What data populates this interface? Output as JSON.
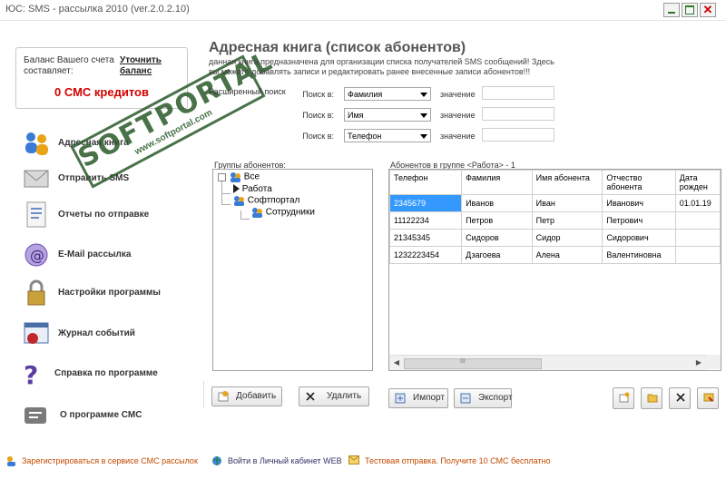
{
  "window": {
    "title": "ЮС: SMS - рассылка 2010 (ver.2.0.2.10)",
    "close_glyph": "✕"
  },
  "balance": {
    "label": "Баланс Вашего счета составляет:",
    "refresh_link": "Уточнить баланс",
    "value": "0 СМС кредитов",
    "value_color": "#d40000"
  },
  "nav": [
    {
      "label": "Адресная книга",
      "icon": "address-book-icon"
    },
    {
      "label": "Отправить SMS",
      "icon": "envelope-icon"
    },
    {
      "label": "Отчеты по отправке",
      "icon": "report-icon"
    },
    {
      "label": "E-Mail рассылка",
      "icon": "email-icon"
    },
    {
      "label": "Настройки программы",
      "icon": "lock-icon"
    },
    {
      "label": "Журнал событий",
      "icon": "log-icon"
    },
    {
      "label": "Справка по программе",
      "icon": "help-icon"
    },
    {
      "label": "О программе СМС",
      "icon": "about-icon"
    }
  ],
  "watermark": {
    "main": "SOFTPORTAL",
    "sub": "www.softportal.com"
  },
  "header": {
    "title": "Адресная книга (список абонентов)",
    "description": "данная книга предназначена для организации списка получателей SMS сообщений! Здесь вы можете добавлять записи и редактировать ранее внесенные записи абонентов!!!"
  },
  "search": {
    "hidden_label": "Расширенный поиск",
    "rows": [
      {
        "label": "Поиск в:",
        "selected": "Фамилия",
        "value_label": "значение",
        "value": ""
      },
      {
        "label": "Поиск в:",
        "selected": "Имя",
        "value_label": "значение",
        "value": ""
      },
      {
        "label": "Поиск в:",
        "selected": "Телефон",
        "value_label": "значение",
        "value": ""
      }
    ]
  },
  "groups": {
    "label": "Группы абонентов:",
    "tree": [
      {
        "label": "Все"
      },
      {
        "label": "Работа"
      },
      {
        "label": "Софтпортал"
      },
      {
        "label": "Сотрудники"
      }
    ]
  },
  "grid": {
    "label": "Абонентов в группе <Работа> - 1",
    "columns": [
      "Телефон",
      "Фамилия",
      "Имя абонента",
      "Отчество абонента",
      "Дата рожден"
    ],
    "rows": [
      [
        "2345679",
        "Иванов",
        "Иван",
        "Иванович",
        "01.01.19"
      ],
      [
        "11122234",
        "Петров",
        "Петр",
        "Петрович",
        ""
      ],
      [
        "21345345",
        "Сидоров",
        "Сидор",
        "Сидорович",
        ""
      ],
      [
        "1232223454",
        "Дзагоева",
        "Алена",
        "Валентиновна",
        ""
      ]
    ],
    "scroll_left": "◀",
    "scroll_mid": "III",
    "scroll_right": "▶"
  },
  "buttons": {
    "add": "Добавить",
    "delete": "Удалить",
    "import": "Импорт",
    "export": "Экспорт"
  },
  "bottom_links": [
    {
      "label": "Зарегистрироваться в сервисе СМС рассылок"
    },
    {
      "label": "Войти в Личный кабинет WEB"
    },
    {
      "label": "Тестовая отправка. Получите 10 СМС бесплатно"
    }
  ],
  "colors": {
    "accent_blue": "#3399ff",
    "link_orange": "#c44a00",
    "watermark_green": "#2a5a2a"
  }
}
